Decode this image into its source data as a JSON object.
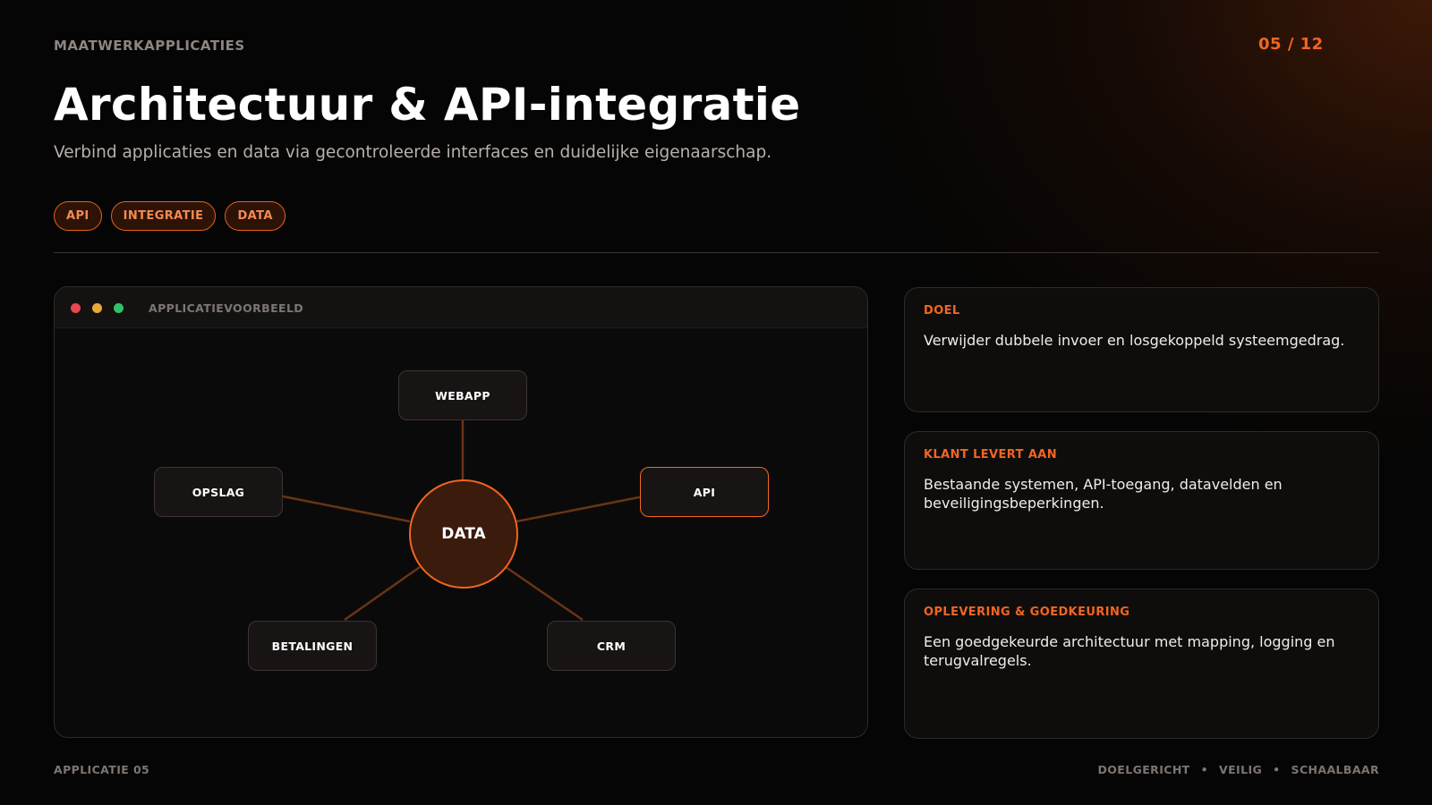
{
  "header": {
    "eyebrow": "MAATWERKAPPLICATIES",
    "page_counter": "05 / 12",
    "title": "Architectuur & API-integratie",
    "subtitle": "Verbind applicaties en data via gecontroleerde interfaces en duidelijke eigenaarschap.",
    "tags": [
      "API",
      "INTEGRATIE",
      "DATA"
    ]
  },
  "window": {
    "label": "APPLICATIEVOORBEELD",
    "diagram": {
      "hub": "DATA",
      "nodes": [
        "WEBAPP",
        "OPSLAG",
        "API",
        "BETALINGEN",
        "CRM"
      ],
      "highlighted_node": "API"
    }
  },
  "cards": [
    {
      "label": "DOEL",
      "text": "Verwijder dubbele invoer en losgekoppeld systeemgedrag."
    },
    {
      "label": "KLANT LEVERT AAN",
      "text": "Bestaande systemen, API-toegang, datavelden en beveiligingsbeperkingen."
    },
    {
      "label": "OPLEVERING & GOEDKEURING",
      "text": "Een goedgekeurde architectuur met mapping, logging en terugvalregels."
    }
  ],
  "footer": {
    "left": "APPLICATIE 05",
    "right": [
      "DOELGERICHT",
      "VEILIG",
      "SCHAALBAAR"
    ],
    "separator": "•"
  },
  "colors": {
    "accent": "#f26522",
    "background": "#050505",
    "panel": "#0b0a0a",
    "muted_text": "#7d7570"
  }
}
